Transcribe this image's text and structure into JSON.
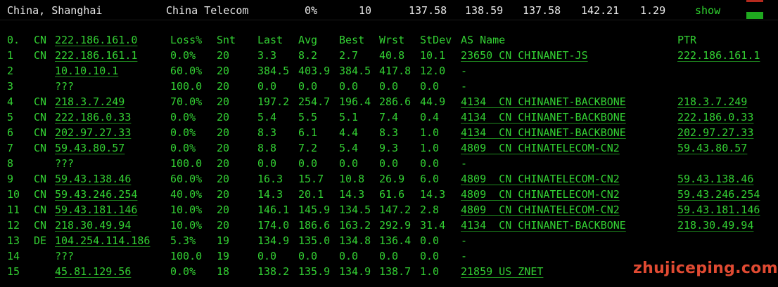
{
  "summary": {
    "location": "China, Shanghai",
    "isp": "China Telecom",
    "loss": "0%",
    "sent": "10",
    "last": "137.58",
    "avg": "138.59",
    "best": "137.58",
    "worst": "142.21",
    "stdev": "1.29",
    "show_label": "show"
  },
  "table": {
    "headers": {
      "hop": "0.",
      "cc": "CN",
      "host": "222.186.161.0",
      "loss": "Loss%",
      "snt": "Snt",
      "last": "Last",
      "avg": "Avg",
      "best": "Best",
      "wrst": "Wrst",
      "stdev": "StDev",
      "as": "AS Name",
      "ptr": "PTR"
    },
    "rows": [
      {
        "hop": "1",
        "cc": "CN",
        "host": "222.186.161.1",
        "loss": "0.0%",
        "snt": "20",
        "last": "3.3",
        "avg": "8.2",
        "best": "2.7",
        "wrst": "40.8",
        "stdev": "10.1",
        "as": "23650 CN CHINANET-JS",
        "ptr": "222.186.161.1"
      },
      {
        "hop": "2",
        "cc": "",
        "host": "10.10.10.1",
        "loss": "60.0%",
        "snt": "20",
        "last": "384.5",
        "avg": "403.9",
        "best": "384.5",
        "wrst": "417.8",
        "stdev": "12.0",
        "as": "-",
        "ptr": ""
      },
      {
        "hop": "3",
        "cc": "",
        "host": "???",
        "loss": "100.0",
        "snt": "20",
        "last": "0.0",
        "avg": "0.0",
        "best": "0.0",
        "wrst": "0.0",
        "stdev": "0.0",
        "as": "-",
        "ptr": ""
      },
      {
        "hop": "4",
        "cc": "CN",
        "host": "218.3.7.249",
        "loss": "70.0%",
        "snt": "20",
        "last": "197.2",
        "avg": "254.7",
        "best": "196.4",
        "wrst": "286.6",
        "stdev": "44.9",
        "as": "4134  CN CHINANET-BACKBONE",
        "ptr": "218.3.7.249"
      },
      {
        "hop": "5",
        "cc": "CN",
        "host": "222.186.0.33",
        "loss": "0.0%",
        "snt": "20",
        "last": "5.4",
        "avg": "5.5",
        "best": "5.1",
        "wrst": "7.4",
        "stdev": "0.4",
        "as": "4134  CN CHINANET-BACKBONE",
        "ptr": "222.186.0.33"
      },
      {
        "hop": "6",
        "cc": "CN",
        "host": "202.97.27.33",
        "loss": "0.0%",
        "snt": "20",
        "last": "8.3",
        "avg": "6.1",
        "best": "4.4",
        "wrst": "8.3",
        "stdev": "1.0",
        "as": "4134  CN CHINANET-BACKBONE",
        "ptr": "202.97.27.33"
      },
      {
        "hop": "7",
        "cc": "CN",
        "host": "59.43.80.57",
        "loss": "0.0%",
        "snt": "20",
        "last": "8.8",
        "avg": "7.2",
        "best": "5.4",
        "wrst": "9.3",
        "stdev": "1.0",
        "as": "4809  CN CHINATELECOM-CN2",
        "ptr": "59.43.80.57"
      },
      {
        "hop": "8",
        "cc": "",
        "host": "???",
        "loss": "100.0",
        "snt": "20",
        "last": "0.0",
        "avg": "0.0",
        "best": "0.0",
        "wrst": "0.0",
        "stdev": "0.0",
        "as": "-",
        "ptr": ""
      },
      {
        "hop": "9",
        "cc": "CN",
        "host": "59.43.138.46",
        "loss": "60.0%",
        "snt": "20",
        "last": "16.3",
        "avg": "15.7",
        "best": "10.8",
        "wrst": "26.9",
        "stdev": "6.0",
        "as": "4809  CN CHINATELECOM-CN2",
        "ptr": "59.43.138.46"
      },
      {
        "hop": "10",
        "cc": "CN",
        "host": "59.43.246.254",
        "loss": "40.0%",
        "snt": "20",
        "last": "14.3",
        "avg": "20.1",
        "best": "14.3",
        "wrst": "61.6",
        "stdev": "14.3",
        "as": "4809  CN CHINATELECOM-CN2",
        "ptr": "59.43.246.254"
      },
      {
        "hop": "11",
        "cc": "CN",
        "host": "59.43.181.146",
        "loss": "10.0%",
        "snt": "20",
        "last": "146.1",
        "avg": "145.9",
        "best": "134.5",
        "wrst": "147.2",
        "stdev": "2.8",
        "as": "4809  CN CHINATELECOM-CN2",
        "ptr": "59.43.181.146"
      },
      {
        "hop": "12",
        "cc": "CN",
        "host": "218.30.49.94",
        "loss": "10.0%",
        "snt": "20",
        "last": "174.0",
        "avg": "186.6",
        "best": "163.2",
        "wrst": "292.9",
        "stdev": "31.4",
        "as": "4134  CN CHINANET-BACKBONE",
        "ptr": "218.30.49.94"
      },
      {
        "hop": "13",
        "cc": "DE",
        "host": "104.254.114.186",
        "loss": "5.3%",
        "snt": "19",
        "last": "134.9",
        "avg": "135.0",
        "best": "134.8",
        "wrst": "136.4",
        "stdev": "0.0",
        "as": "-",
        "ptr": ""
      },
      {
        "hop": "14",
        "cc": "",
        "host": "???",
        "loss": "100.0",
        "snt": "19",
        "last": "0.0",
        "avg": "0.0",
        "best": "0.0",
        "wrst": "0.0",
        "stdev": "0.0",
        "as": "-",
        "ptr": ""
      },
      {
        "hop": "15",
        "cc": "",
        "host": "45.81.129.56",
        "loss": "0.0%",
        "snt": "18",
        "last": "138.2",
        "avg": "135.9",
        "best": "134.9",
        "wrst": "138.7",
        "stdev": "1.0",
        "as": "21859 US ZNET",
        "ptr": ""
      }
    ]
  },
  "watermark": "zhujiceping.com",
  "colors": {
    "background": "#000000",
    "terminal_green": "#33d033",
    "summary_text": "#e8e8e8",
    "indicator_red": "#b52a1e",
    "indicator_green": "#1fa81f",
    "watermark": "#e04a32"
  }
}
